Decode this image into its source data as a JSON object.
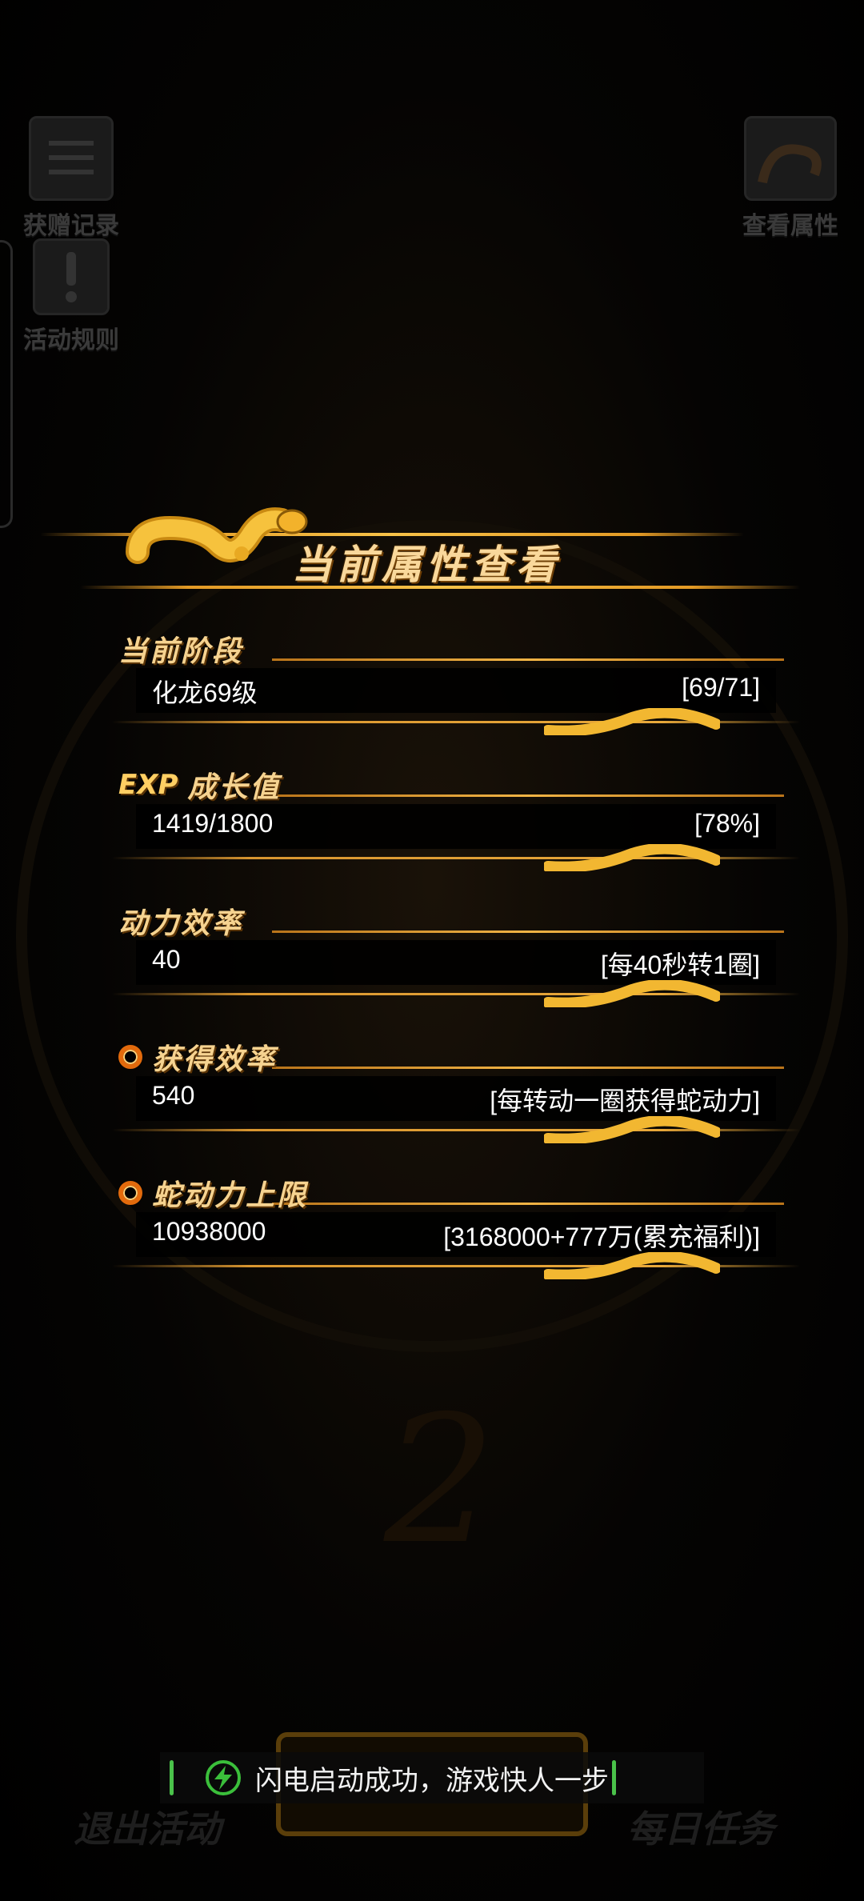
{
  "background": {
    "top_left_buttons": [
      {
        "label": "获赠记录",
        "icon": "list-icon"
      },
      {
        "label": "活动规则",
        "icon": "exclamation-icon"
      }
    ],
    "top_right_button": {
      "label": "查看属性",
      "icon": "snake-icon"
    },
    "bottom_left_button": {
      "label": "退出活动",
      "icon": "exit-door-icon"
    },
    "bottom_right_button": {
      "label": "每日任务",
      "icon": "scroll-icon"
    }
  },
  "modal": {
    "title": "当前属性查看",
    "sections": [
      {
        "label": "当前阶段",
        "prefix": "",
        "value": "化龙69级",
        "note": "[69/71]"
      },
      {
        "label": "成长值",
        "prefix": "EXP",
        "value": "1419/1800",
        "note": "[78%]"
      },
      {
        "label": "动力效率",
        "prefix": "",
        "value": "40",
        "note": "[每40秒转1圈]"
      },
      {
        "label": "获得效率",
        "prefix": "ring",
        "value": "540",
        "note": "[每转动一圈获得蛇动力]"
      },
      {
        "label": "蛇动力上限",
        "prefix": "ring",
        "value": "10938000",
        "note": "[3168000+777万(累充福利)]"
      }
    ]
  },
  "toast": {
    "message": "闪电启动成功，游戏快人一步",
    "icon": "lightning-icon",
    "accent_color": "#3bbf3b"
  },
  "colors": {
    "gold": "#f7c248",
    "label": "#f6d390",
    "background": "#000000"
  }
}
